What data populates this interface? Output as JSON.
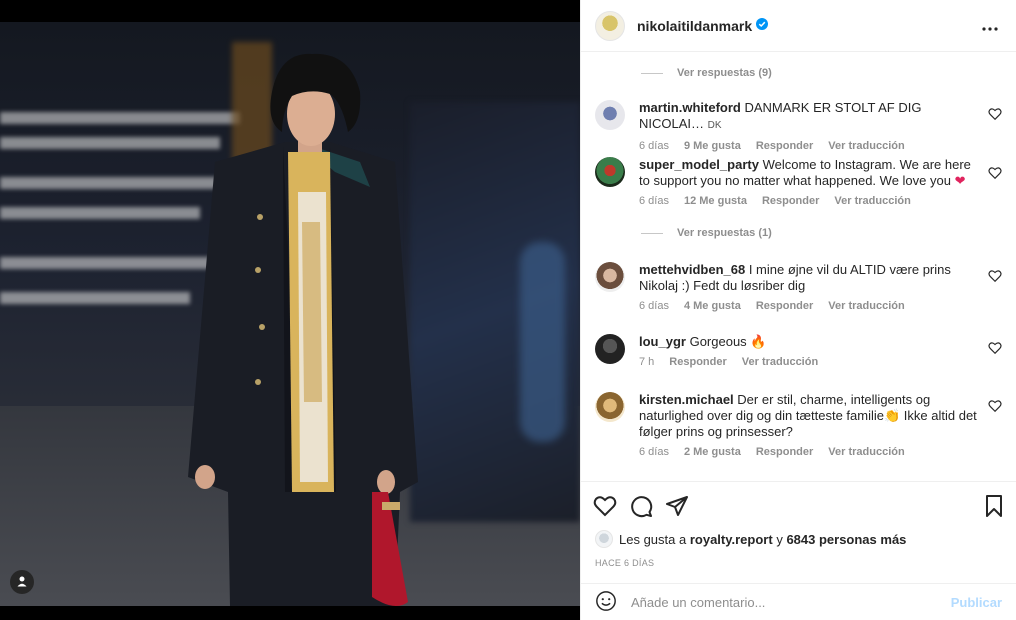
{
  "post": {
    "username": "nikolaitildanmark",
    "verified": true,
    "more_icon": "more-horizontal-icon"
  },
  "comments": {
    "top_view_replies": "Ver respuestas (9)",
    "items": [
      {
        "username": "martin.whiteford",
        "text": "DANMARK ER STOLT AF DIG NICOLAI…",
        "suffix": "DK",
        "time": "6 días",
        "likes": "9 Me gusta",
        "reply": "Responder",
        "translate": "Ver traducción"
      },
      {
        "username": "super_model_party",
        "text": "Welcome to Instagram. We are here to support you no matter what happened. We love you",
        "emoji": "❤",
        "time": "6 días",
        "likes": "12 Me gusta",
        "reply": "Responder",
        "translate": "Ver traducción",
        "view_replies": "Ver respuestas (1)"
      },
      {
        "username": "mettehvidben_68",
        "text": "I mine øjne vil du ALTID være prins Nikolaj :) Fedt du løsriber dig",
        "time": "6 días",
        "likes": "4 Me gusta",
        "reply": "Responder",
        "translate": "Ver traducción"
      },
      {
        "username": "lou_ygr",
        "text": "Gorgeous",
        "emoji": "🔥",
        "time": "7 h",
        "reply": "Responder",
        "translate": "Ver traducción"
      },
      {
        "username": "kirsten.michael",
        "text": "Der er stil, charme, intelligents og naturlighed over dig og din tætteste familie",
        "emoji": "👏",
        "text2": "Ikke altid det følger prins og prinsesser?",
        "time": "6 días",
        "likes": "2 Me gusta",
        "reply": "Responder",
        "translate": "Ver traducción"
      }
    ]
  },
  "actions": {
    "icons": [
      "heart-icon",
      "comment-icon",
      "share-icon",
      "bookmark-icon"
    ]
  },
  "likes_line": {
    "prefix": "Les gusta a",
    "user": "royalty.report",
    "joiner": "y",
    "others": "6843 personas más"
  },
  "posted": "HACE 6 DÍAS",
  "add_comment": {
    "placeholder": "Añade un comentario...",
    "publish": "Publicar"
  },
  "colors": {
    "text": "#262626",
    "muted": "#8e8e8e",
    "link_disabled": "#b3dbff",
    "verified": "#0095f6",
    "heart_red": "#e0245e"
  }
}
